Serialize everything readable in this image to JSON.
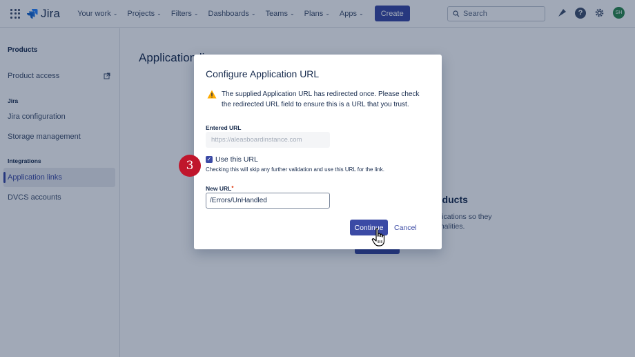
{
  "topnav": {
    "logo_text": "Jira",
    "items": [
      {
        "label": "Your work"
      },
      {
        "label": "Projects"
      },
      {
        "label": "Filters"
      },
      {
        "label": "Dashboards"
      },
      {
        "label": "Teams"
      },
      {
        "label": "Plans"
      },
      {
        "label": "Apps"
      }
    ],
    "create_label": "Create",
    "search_placeholder": "Search",
    "avatar_initials": "SH"
  },
  "sidebar": {
    "heading": "Products",
    "product_access": "Product access",
    "jira_section": "Jira",
    "jira_configuration": "Jira configuration",
    "storage_management": "Storage management",
    "integrations_section": "Integrations",
    "application_links": "Application links",
    "dvcs_accounts": "DVCS accounts"
  },
  "main": {
    "title": "Application li",
    "bg_heading": "oducts",
    "bg_text1": "plications so they",
    "bg_text2": "onalities."
  },
  "dialog": {
    "title": "Configure Application URL",
    "warning_line1": "The supplied Application URL has redirected once. Please check",
    "warning_line2": "the redirected URL field to ensure this is a URL that you trust.",
    "entered_url_label": "Entered URL",
    "entered_url_value": "https://aleasboardinstance.com",
    "use_url_label": "Use this URL",
    "use_url_checked": true,
    "use_url_help": "Checking this will skip any further validation and use this URL for the link.",
    "new_url_label": "New URL",
    "required_marker": "*",
    "new_url_value": "/Errors/UnHandled",
    "continue_label": "Continue",
    "cancel_label": "Cancel"
  },
  "step_badge": "3",
  "colors": {
    "primary": "#3b4aa5",
    "warning": "#ffab00",
    "badge": "#c0162c",
    "avatar": "#2c8a4e"
  }
}
